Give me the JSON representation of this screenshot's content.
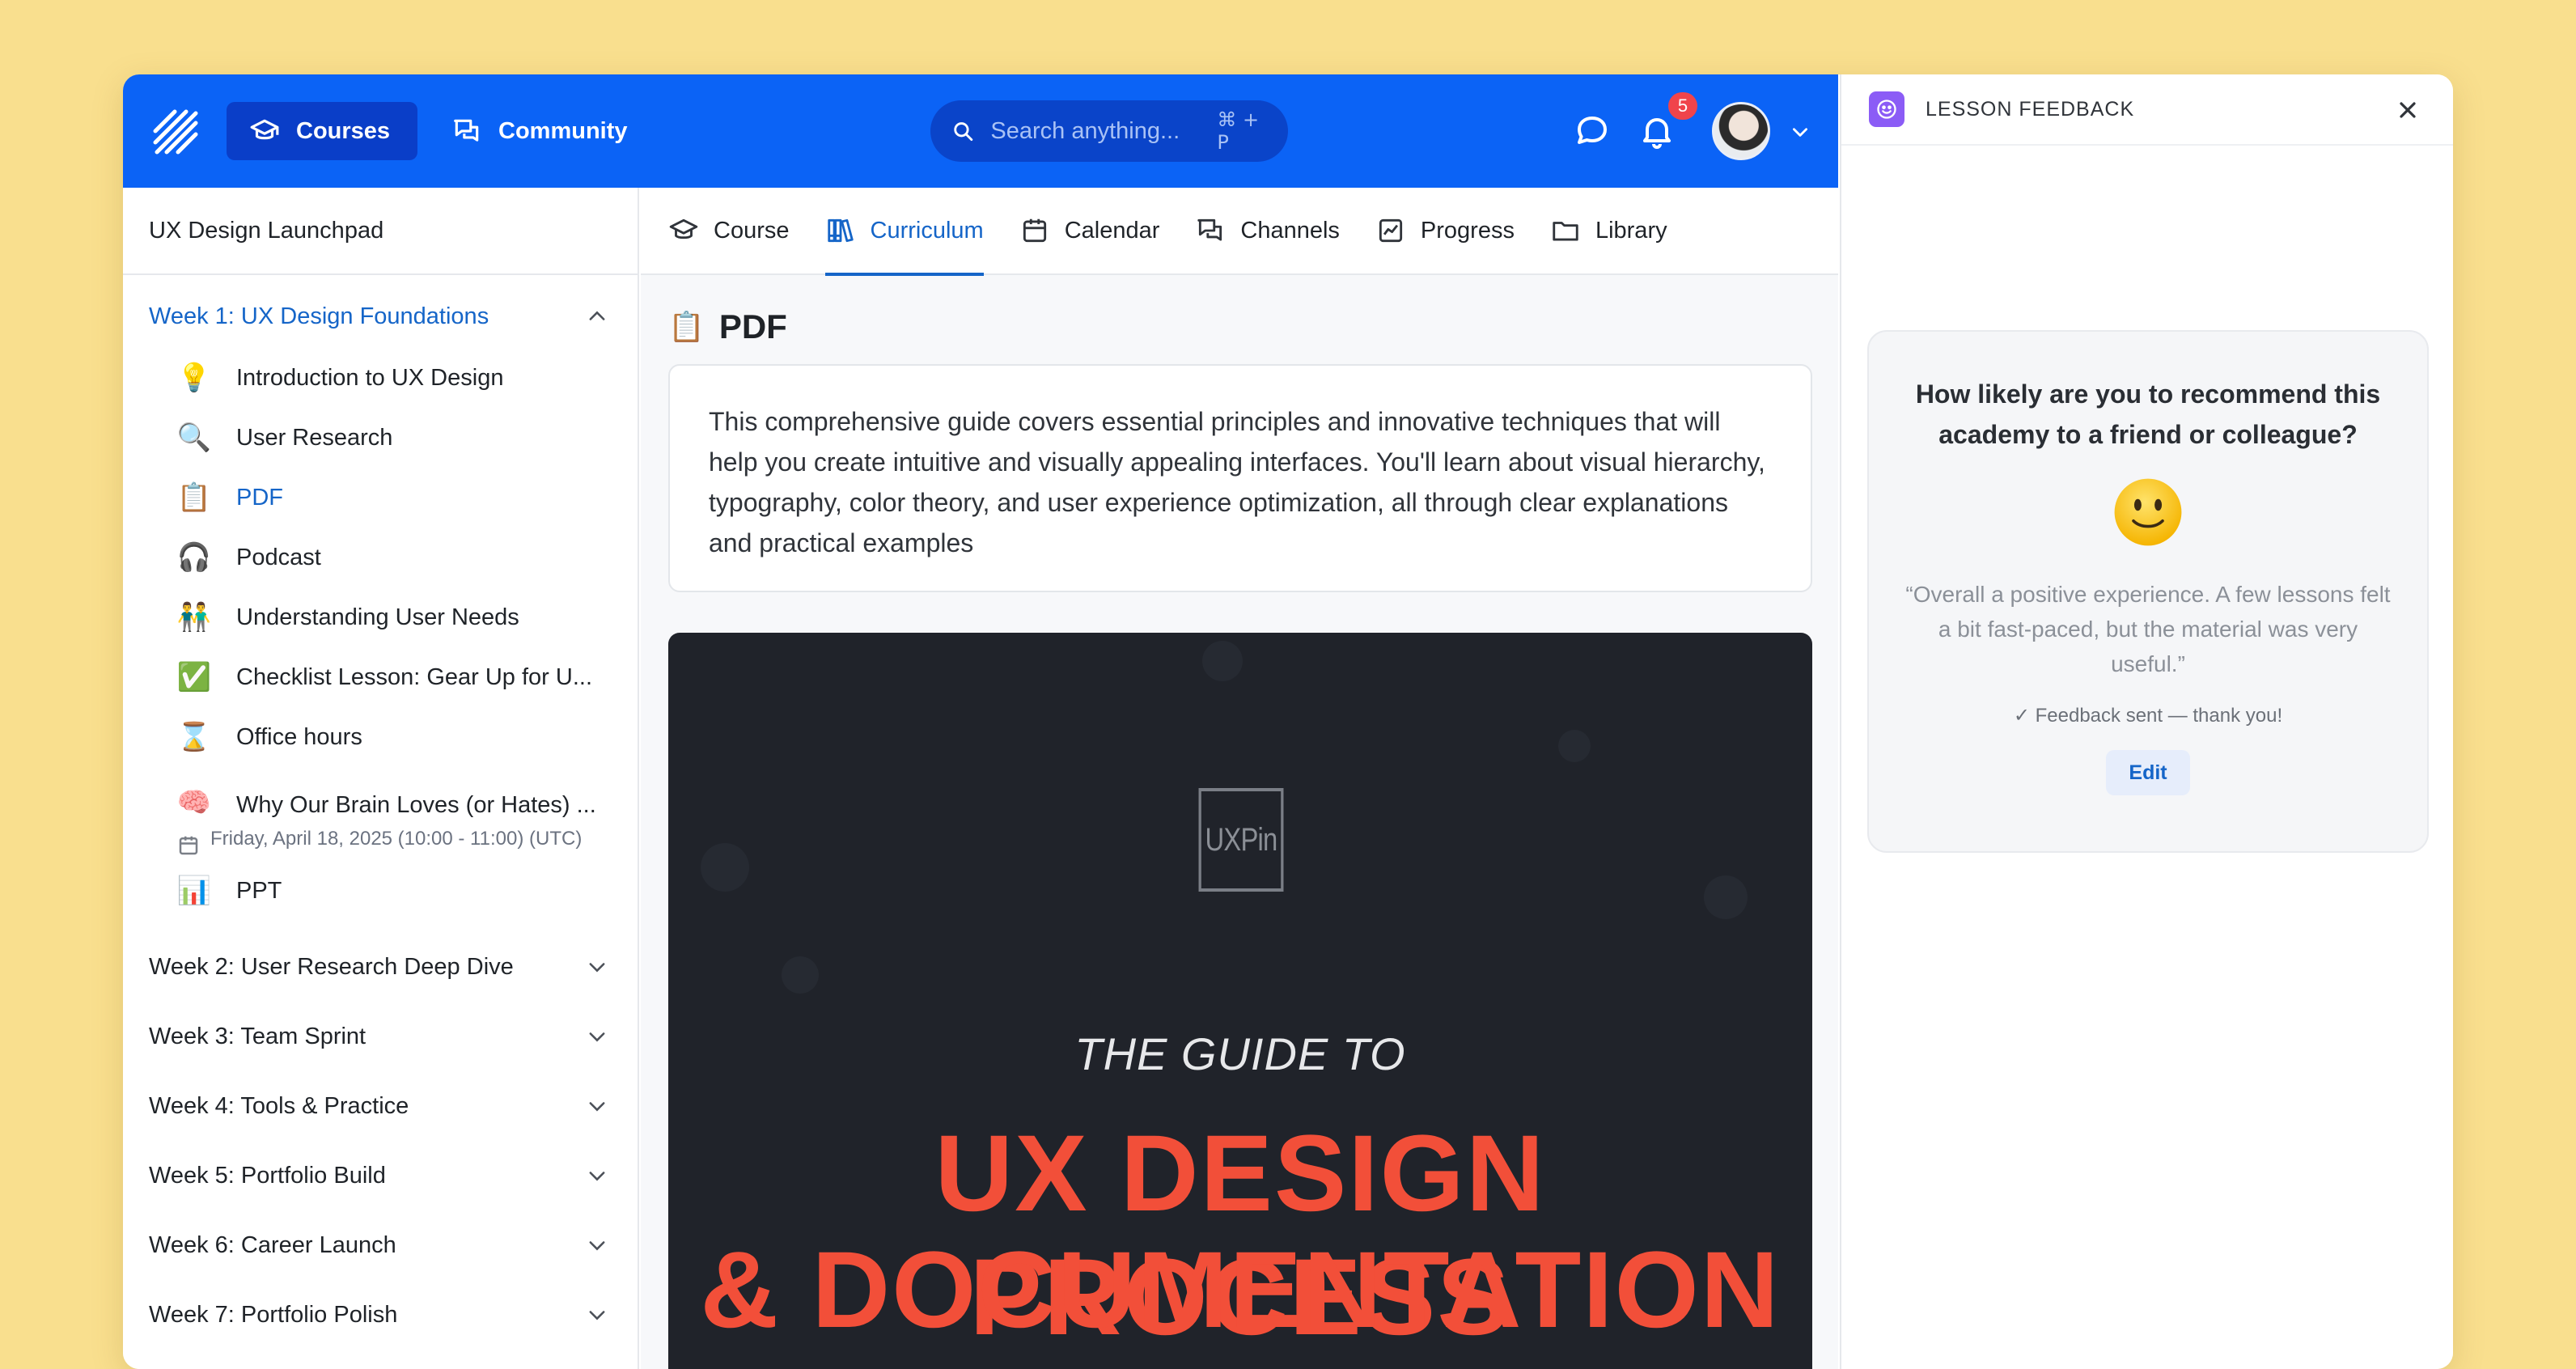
{
  "header": {
    "nav": [
      {
        "label": "Courses",
        "icon": "graduation-cap-icon"
      },
      {
        "label": "Community",
        "icon": "chat-bubbles-icon"
      }
    ],
    "search": {
      "placeholder": "Search anything...",
      "shortcut": "⌘ + P"
    },
    "notification_count": "5",
    "accent": "#0B63F6"
  },
  "sidebar": {
    "title": "UX Design Launchpad",
    "open_week": "Week 1: UX Design Foundations",
    "lessons": [
      {
        "emoji": "💡",
        "label": "Introduction to UX Design"
      },
      {
        "emoji": "🔍",
        "label": "User Research"
      },
      {
        "emoji": "📋",
        "label": "PDF"
      },
      {
        "emoji": "🎧",
        "label": "Podcast"
      },
      {
        "emoji": "👬",
        "label": "Understanding User Needs"
      },
      {
        "emoji": "✅",
        "label": "Checklist Lesson: Gear Up for U..."
      },
      {
        "emoji": "⌛",
        "label": "Office hours"
      },
      {
        "emoji": "🧠",
        "label": "Why Our Brain Loves (or Hates) ..."
      },
      {
        "emoji": "📊",
        "label": "PPT"
      }
    ],
    "event_date": "Friday, April 18, 2025 (10:00 - 11:00) (UTC)",
    "weeks": [
      "Week 2: User Research Deep Dive",
      "Week 3: Team Sprint",
      "Week 4: Tools & Practice",
      "Week 5: Portfolio Build",
      "Week 6: Career Launch",
      "Week 7: Portfolio Polish"
    ]
  },
  "main": {
    "tabs": [
      "Course",
      "Curriculum",
      "Calendar",
      "Channels",
      "Progress",
      "Library"
    ],
    "active_tab": "Curriculum",
    "page_title": "PDF",
    "page_emoji": "📋",
    "description": "This comprehensive guide covers essential principles and innovative techniques that will help you create intuitive and visually appealing interfaces. You'll learn about visual hierarchy, typography, color theory, and user experience optimization, all through clear explanations and practical examples",
    "pdf": {
      "logo": "UXPin",
      "subtitle": "THE GUIDE TO",
      "title_line1": "UX DESIGN PROCESS",
      "title_line2": "& DOCUMENTATION"
    }
  },
  "panel": {
    "title": "LESSON FEEDBACK",
    "question": "How likely are you to recommend this academy to a friend or colleague?",
    "quote": "“Overall a positive experience. A few lessons felt a bit fast-paced, but the material was very useful.”",
    "status": "✓ Feedback sent — thank you!",
    "edit_label": "Edit"
  }
}
